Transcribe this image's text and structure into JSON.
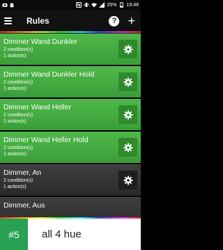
{
  "status": {
    "left_icons": [
      "camera-icon",
      "android-icon"
    ],
    "right_icons": [
      "nfc-icon",
      "vibrate-icon",
      "wifi-icon",
      "signal-icon",
      "battery-icon"
    ],
    "battery": "25%",
    "time": "19:48"
  },
  "appbar": {
    "title": "Rules",
    "help": "?",
    "add": "+"
  },
  "rules": [
    {
      "name": "Dimmer Wand Dunkler",
      "conditions": "2 condition(s)",
      "actions": "1 action(s)",
      "active": true
    },
    {
      "name": "Dimmer Wand Dunkler Hold",
      "conditions": "2 condition(s)",
      "actions": "1 action(s)",
      "active": true
    },
    {
      "name": "Dimmer Wand Heller",
      "conditions": "2 condition(s)",
      "actions": "1 action(s)",
      "active": true
    },
    {
      "name": "Dimmer Wand Heller Hold",
      "conditions": "2 condition(s)",
      "actions": "1 action(s)",
      "active": true
    },
    {
      "name": "Dimmer, An",
      "conditions": "2 condition(s)",
      "actions": "1 action(s)",
      "active": false
    },
    {
      "name": "Dimmer, Aus",
      "conditions": "",
      "actions": "",
      "active": false
    }
  ],
  "colors": {
    "active": "#3fa83c",
    "inactive": "#333333",
    "rank_badge": "#27a152"
  },
  "banner": {
    "rank": "#5",
    "text": "all 4 hue"
  }
}
